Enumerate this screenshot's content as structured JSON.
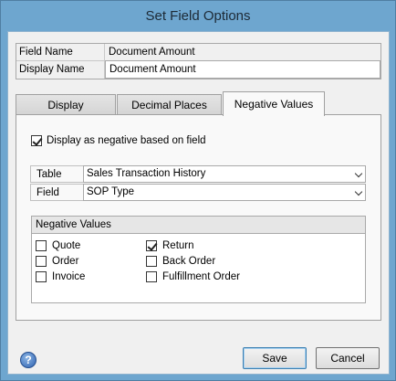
{
  "window": {
    "title": "Set Field Options"
  },
  "fields": {
    "field_name": {
      "label": "Field Name",
      "value": "Document Amount"
    },
    "display_name": {
      "label": "Display Name",
      "value": "Document Amount"
    }
  },
  "tabs": [
    {
      "label": "Display",
      "active": false
    },
    {
      "label": "Decimal Places",
      "active": false
    },
    {
      "label": "Negative Values",
      "active": true
    }
  ],
  "negative_tab": {
    "display_negative_checkbox": {
      "label": "Display as negative based on field",
      "checked": true
    },
    "table": {
      "label": "Table",
      "value": "Sales Transaction History"
    },
    "field": {
      "label": "Field",
      "value": "SOP Type"
    },
    "group_title": "Negative Values",
    "options": [
      {
        "label": "Quote",
        "checked": false
      },
      {
        "label": "Order",
        "checked": false
      },
      {
        "label": "Invoice",
        "checked": false
      },
      {
        "label": "Return",
        "checked": true
      },
      {
        "label": "Back Order",
        "checked": false
      },
      {
        "label": "Fulfillment Order",
        "checked": false
      }
    ]
  },
  "buttons": {
    "save": "Save",
    "cancel": "Cancel"
  },
  "icons": {
    "help": "help-icon"
  },
  "colors": {
    "title_bar": "#6ea6cf",
    "client": "#f0f0f0"
  }
}
